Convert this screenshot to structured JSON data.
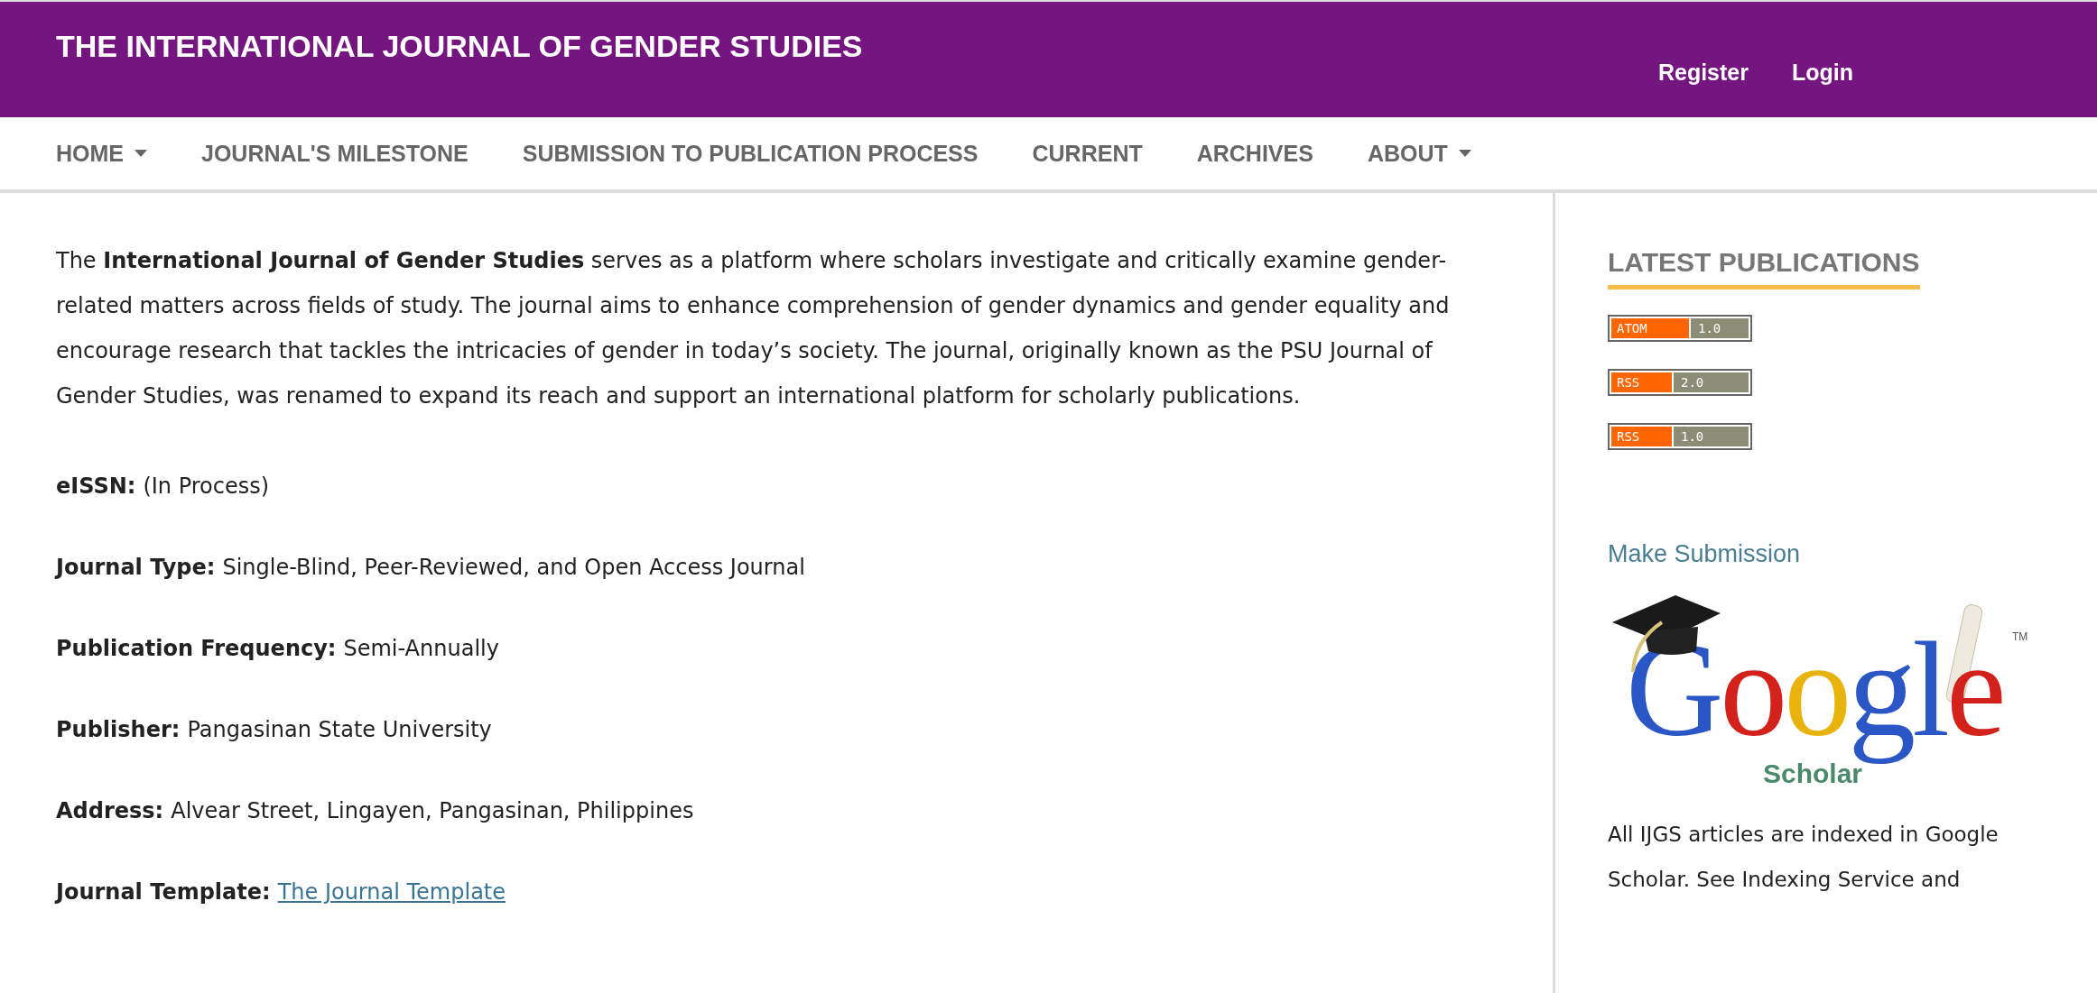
{
  "header": {
    "title": "THE INTERNATIONAL JOURNAL OF GENDER STUDIES",
    "user_links": [
      "Register",
      "Login"
    ]
  },
  "nav": [
    {
      "label": "HOME",
      "dropdown": true
    },
    {
      "label": "JOURNAL'S MILESTONE",
      "dropdown": false
    },
    {
      "label": "SUBMISSION TO PUBLICATION PROCESS",
      "dropdown": false
    },
    {
      "label": "CURRENT",
      "dropdown": false
    },
    {
      "label": "ARCHIVES",
      "dropdown": false
    },
    {
      "label": "ABOUT",
      "dropdown": true
    }
  ],
  "main": {
    "intro": "The **International Journal of Gender Studies** serves as a platform where scholars investigate and critically examine gender-related matters across fields of study. The journal aims to enhance comprehension of gender dynamics and gender equality and encourage research that tackles the intricacies of gender in today’s society. The journal, originally known as the PSU Journal of Gender Studies, was renamed to expand its reach and support an international platform for scholarly publications.",
    "fields": [
      {
        "label": "eISSN:",
        "value": "(In Process)",
        "kind": "text"
      },
      {
        "label": "Journal Type:",
        "value": "Single-Blind, Peer-Reviewed, and Open Access Journal",
        "kind": "text"
      },
      {
        "label": "Publication Frequency:",
        "value": "Semi-Annually",
        "kind": "text"
      },
      {
        "label": "Publisher:",
        "value": "Pangasinan State University",
        "kind": "text"
      },
      {
        "label": "Address:",
        "value": "Alvear Street, Lingayen, Pangasinan, Philippines",
        "kind": "text"
      },
      {
        "label": "Journal Template:",
        "value": "The Journal Template",
        "kind": "link"
      }
    ]
  },
  "sidebar": {
    "heading": "LATEST PUBLICATIONS",
    "feeds": [
      {
        "format": "ATOM",
        "version": "1.0"
      },
      {
        "format": "RSS",
        "version": "2.0"
      },
      {
        "format": "RSS",
        "version": "1.0"
      }
    ],
    "submission_link": "Make Submission",
    "scholar_logo": {
      "wordmark": "Google",
      "caption": "Scholar",
      "mark": "TM"
    },
    "indexing_note": "All IJGS articles are indexed in Google Scholar. See Indexing Service and"
  }
}
